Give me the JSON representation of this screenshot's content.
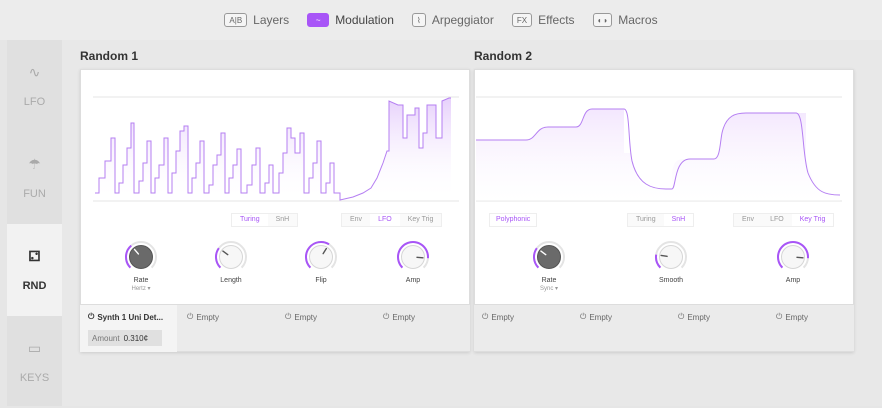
{
  "tabs": [
    {
      "icon": "A|B",
      "label": "Layers",
      "active": false
    },
    {
      "icon": "~",
      "label": "Modulation",
      "active": true
    },
    {
      "icon": "⌇",
      "label": "Arpeggiator",
      "active": false
    },
    {
      "icon": "FX",
      "label": "Effects",
      "active": false
    },
    {
      "icon": "◐◑",
      "label": "Macros",
      "active": false
    }
  ],
  "sidebar": [
    {
      "label": "LFO",
      "icon": "sine-wave-icon",
      "active": false
    },
    {
      "label": "FUN",
      "icon": "mushroom-icon",
      "active": false
    },
    {
      "label": "RND",
      "icon": "dice-icon",
      "active": true
    },
    {
      "label": "KEYS",
      "icon": "keyboard-icon",
      "active": false
    }
  ],
  "random1": {
    "title": "Random 1",
    "mode": [
      "Turing",
      "SnH"
    ],
    "mode_active": "Turing",
    "trig": [
      "Env",
      "LFO",
      "Key Trig"
    ],
    "trig_active": "LFO",
    "knobs": [
      {
        "label": "Rate",
        "sub": "Hertz ▾",
        "style": "dark",
        "level": 0.35
      },
      {
        "label": "Length",
        "sub": "",
        "style": "light",
        "level": 0.3
      },
      {
        "label": "Flip",
        "sub": "",
        "style": "light",
        "level": 0.62
      },
      {
        "label": "Amp",
        "sub": "",
        "style": "light",
        "level": 0.85
      }
    ],
    "slots": [
      "Synth 1 Uni Det...",
      "Empty",
      "Empty",
      "Empty"
    ],
    "amount_label": "Amount",
    "amount_value": "0.310¢"
  },
  "random2": {
    "title": "Random 2",
    "polyphonic": "Polyphonic",
    "mode": [
      "Turing",
      "SnH"
    ],
    "mode_active": "SnH",
    "trig": [
      "Env",
      "LFO",
      "Key Trig"
    ],
    "trig_active": "Key Trig",
    "knobs": [
      {
        "label": "Rate",
        "sub": "Sync ▾",
        "style": "dark",
        "level": 0.3
      },
      {
        "label": "Smooth",
        "sub": "",
        "style": "light",
        "level": 0.2
      },
      {
        "label": "Amp",
        "sub": "",
        "style": "light",
        "level": 0.85
      }
    ],
    "slots": [
      "Empty",
      "Empty",
      "Empty",
      "Empty"
    ]
  },
  "colors": {
    "accent": "#a855f7",
    "fill": "#efe3fb"
  }
}
